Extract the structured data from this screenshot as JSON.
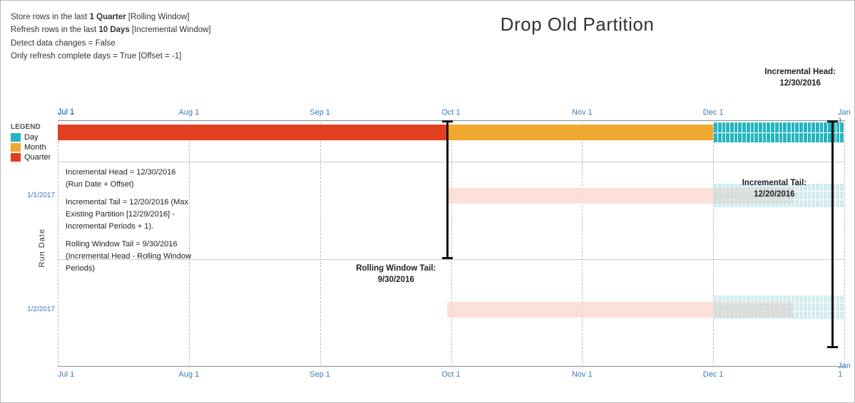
{
  "title": "Drop Old Partition",
  "info": {
    "line1_prefix": "Store rows in the last ",
    "line1_bold": "1 Quarter",
    "line1_suffix": " [Rolling Window]",
    "line2_prefix": "Refresh rows in the last ",
    "line2_bold": "10 Days",
    "line2_suffix": " [Incremental Window]",
    "line3": "Detect data changes = False",
    "line4": "Only refresh complete days = True [Offset = -1]"
  },
  "inc_head_label": "Incremental Head:\n12/30/2016",
  "legend": {
    "title": "LEGEND",
    "items": [
      {
        "label": "Day",
        "color": "#26b5c0"
      },
      {
        "label": "Month",
        "color": "#f0a830"
      },
      {
        "label": "Quarter",
        "color": "#e04020"
      }
    ]
  },
  "axis_labels": [
    "Jul 1",
    "Aug 1",
    "Sep 1",
    "Oct 1",
    "Nov 1",
    "Dec 1",
    "Jan 1"
  ],
  "axis_positions_pct": [
    0,
    16.67,
    33.33,
    50,
    66.67,
    83.33,
    100
  ],
  "run_date_label": "Run Date",
  "row_labels": [
    "1/1/2017",
    "1/2/2017"
  ],
  "annotations": {
    "left_block": {
      "line1": "Incremental Head = 12/30/2016",
      "line2": "(Run Date + Offset)",
      "line3": "",
      "line4": "Incremental Tail = 12/20/2016 (Max",
      "line5": "Existing Partition [12/29/2016] -",
      "line6": "Incremental Periods + 1).",
      "line7": "",
      "line8": "Rolling Window Tail = 9/30/2016",
      "line9": "(Incremental Head - Rolling Window",
      "line10": "Periods)"
    },
    "rolling_window_tail": "Rolling Window Tail:\n9/30/2016",
    "incremental_tail": "Incremental Tail:\n12/20/2016"
  },
  "colors": {
    "quarter_bar": "#e04020",
    "month_bar": "#f0a830",
    "day_tile": "#26b5c0",
    "day_tile_faded": "#c8eaec",
    "ibeam": "#111111",
    "axis_label": "#3a7ab8"
  }
}
